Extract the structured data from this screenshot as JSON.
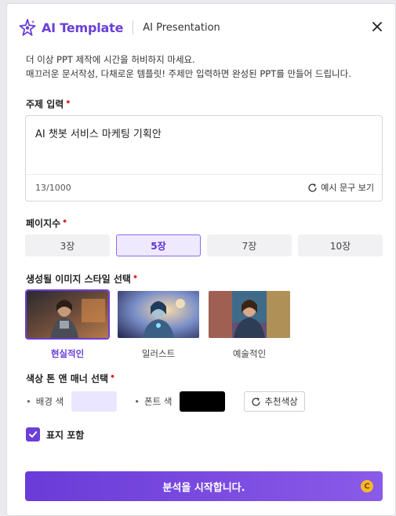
{
  "header": {
    "brand": "AI Template",
    "sub_brand": "AI Presentation",
    "close_icon": "close-icon",
    "logo_icon": "sparkle-logo-icon"
  },
  "intro": {
    "line1": "더 이상 PPT 제작에 시간을 허비하지 마세요.",
    "line2": "매끄러운 문서작성, 다채로운 템플릿! 주제만 입력하면 완성된 PPT를 만들어 드립니다."
  },
  "topic": {
    "label": "주제 입력",
    "required": "•",
    "value": "AI 챗봇 서비스 마케팅 기획안",
    "count": "13/1000",
    "example_label": "예시 문구 보기"
  },
  "pages": {
    "label": "페이지수",
    "required": "•",
    "options": [
      "3장",
      "5장",
      "7장",
      "10장"
    ],
    "selected": "5장"
  },
  "image_style": {
    "label": "생성될 이미지 스타일 선택",
    "required": "•",
    "options": [
      "현실적인",
      "일러스트",
      "예술적인"
    ],
    "selected": "현실적인"
  },
  "color_tone": {
    "label": "색상 톤 앤 매너 선택",
    "required": "•",
    "bg_label": "배경 색",
    "font_label": "폰트 색",
    "bg_color": "#ebe6ff",
    "font_color": "#000000",
    "recommend_label": "추천색상"
  },
  "checkbox": {
    "label": "표지 포함",
    "checked": true
  },
  "start": {
    "label": "분석을 시작합니다.",
    "coin": "C"
  },
  "colors": {
    "accent": "#6b3fd8",
    "required": "#e5252a"
  }
}
